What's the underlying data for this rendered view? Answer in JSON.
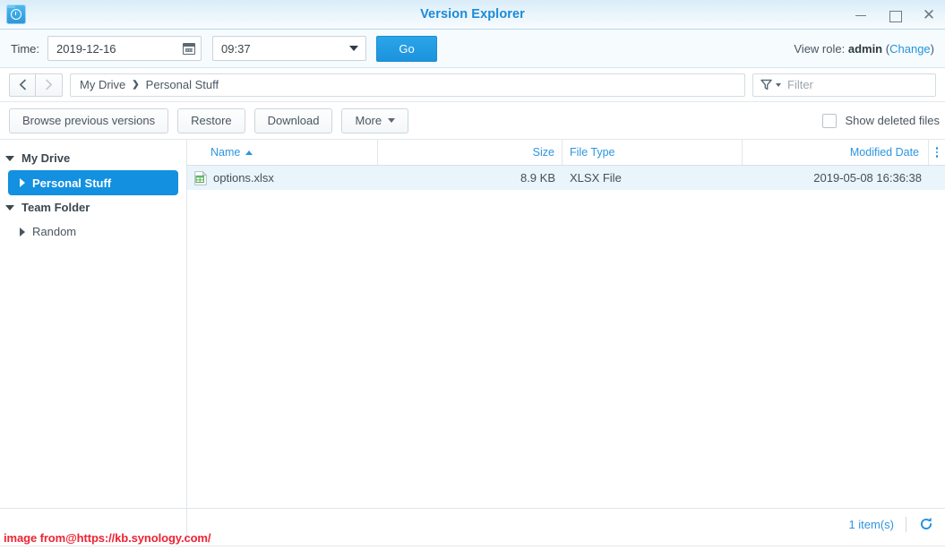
{
  "window": {
    "title": "Version Explorer",
    "app_icon": "folder-clock-icon",
    "minimize_label": "",
    "maximize_label": "",
    "close_label": "✕"
  },
  "timebar": {
    "label": "Time:",
    "date_value": "2019-12-16",
    "date_icon": "calendar-icon",
    "time_value": "09:37",
    "go_label": "Go",
    "view_role_prefix": "View role:",
    "view_role_value": "admin",
    "view_role_change_open": "(",
    "view_role_change": "Change",
    "view_role_change_close": ")"
  },
  "nav": {
    "back_icon": "chevron-left-icon",
    "forward_icon": "chevron-right-icon",
    "breadcrumb": [
      {
        "label": "My Drive"
      },
      {
        "label": "Personal Stuff"
      }
    ],
    "breadcrumb_separator": "❯",
    "filter_icon": "funnel-icon",
    "filter_placeholder": "Filter"
  },
  "toolbar": {
    "browse_label": "Browse previous versions",
    "restore_label": "Restore",
    "download_label": "Download",
    "more_label": "More",
    "show_deleted_label": "Show deleted files",
    "show_deleted_checked": false
  },
  "sidebar": {
    "items": [
      {
        "label": "My Drive",
        "level": 0,
        "expanded": true,
        "selected": false
      },
      {
        "label": "Personal Stuff",
        "level": 1,
        "expanded": false,
        "selected": true
      },
      {
        "label": "Team Folder",
        "level": 0,
        "expanded": true,
        "selected": false
      },
      {
        "label": "Random",
        "level": 1,
        "expanded": false,
        "selected": false
      }
    ]
  },
  "table": {
    "columns": [
      {
        "key": "name",
        "label": "Name",
        "sort": "asc"
      },
      {
        "key": "size",
        "label": "Size",
        "sort": null
      },
      {
        "key": "ftype",
        "label": "File Type",
        "sort": null
      },
      {
        "key": "mdate",
        "label": "Modified Date",
        "sort": null
      }
    ],
    "column_menu_icon": "kebab-menu-icon",
    "rows": [
      {
        "icon": "xlsx-file-icon",
        "name": "options.xlsx",
        "size": "8.9 KB",
        "ftype": "XLSX File",
        "mdate": "2019-05-08 16:36:38",
        "selected": true
      }
    ]
  },
  "status": {
    "item_count": "1 item(s)",
    "refresh_icon": "refresh-icon"
  },
  "watermark": {
    "text": "image from@https://kb.synology.com/"
  },
  "colors": {
    "accent": "#2e95e0",
    "title": "#1b8ad8",
    "selected_row": "#e9f4fb",
    "selected_tree": "#1390e0",
    "watermark": "#ee2332"
  }
}
